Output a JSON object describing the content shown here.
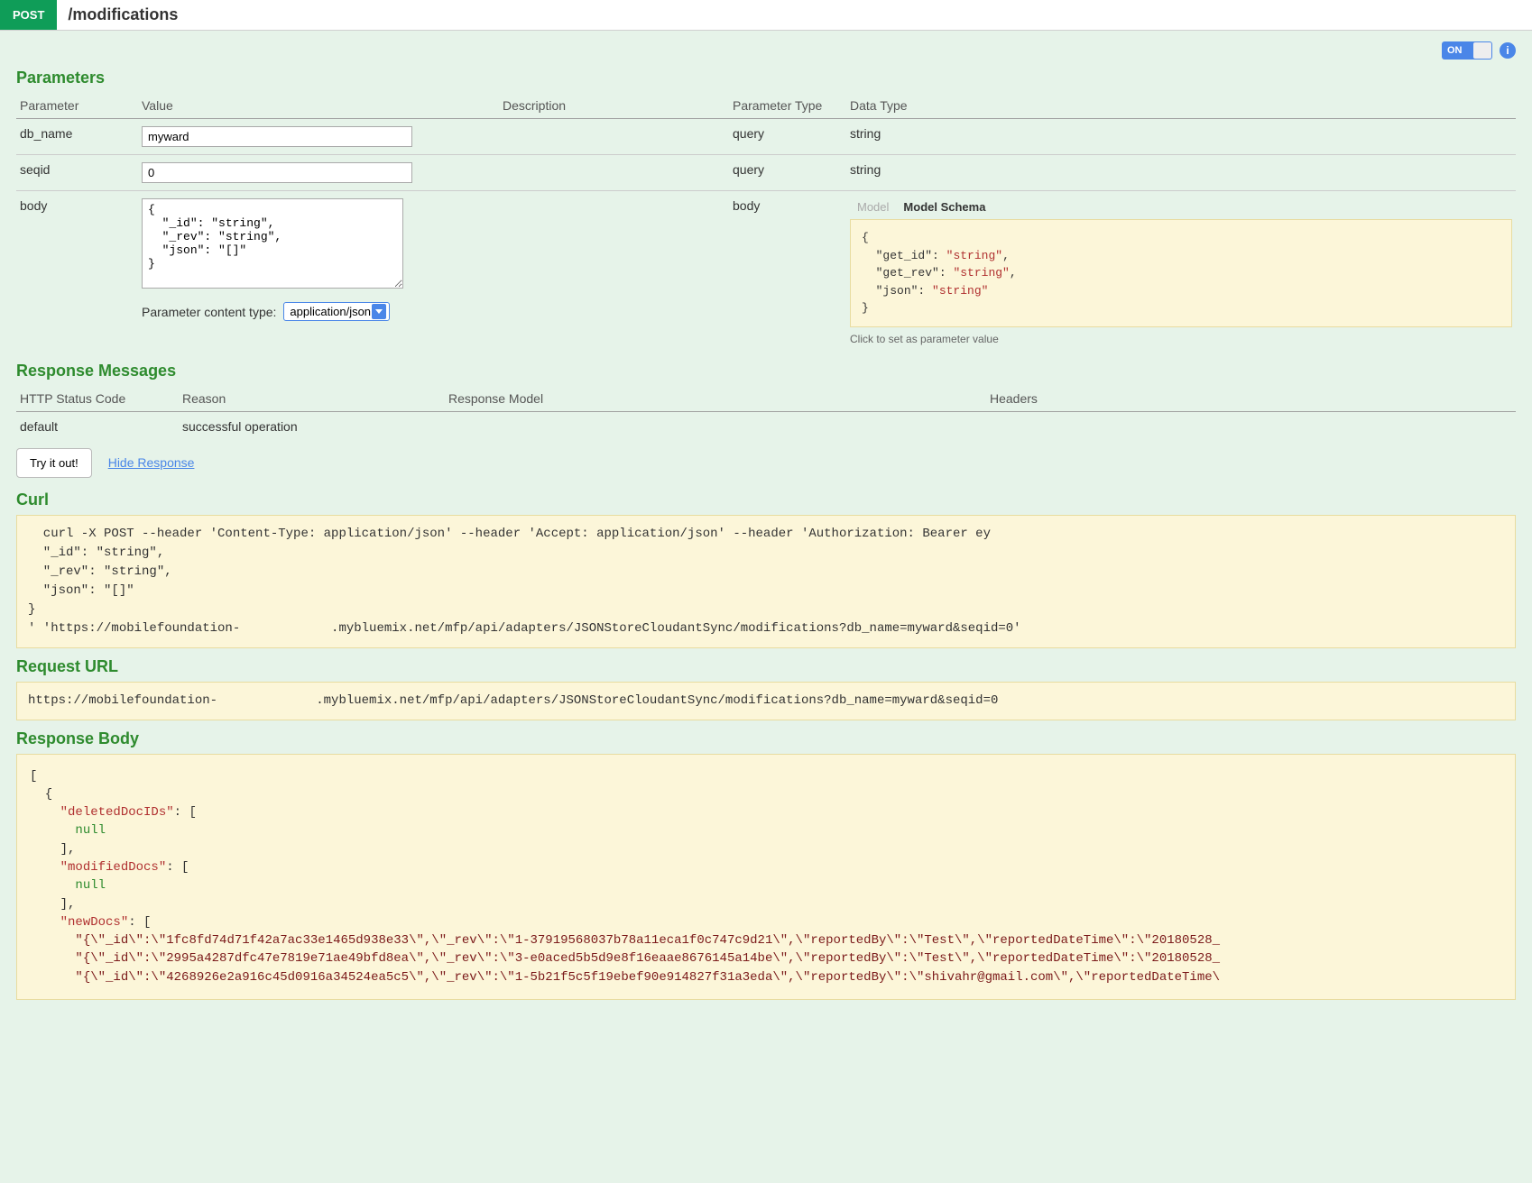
{
  "header": {
    "method": "POST",
    "path": "/modifications"
  },
  "toggle": {
    "state": "ON"
  },
  "parameters": {
    "title": "Parameters",
    "columns": {
      "param": "Parameter",
      "value": "Value",
      "desc": "Description",
      "ptype": "Parameter Type",
      "dtype": "Data Type"
    },
    "rows": {
      "db_name": {
        "name": "db_name",
        "value": "myward",
        "ptype": "query",
        "dtype": "string"
      },
      "seqid": {
        "name": "seqid",
        "value": "0",
        "ptype": "query",
        "dtype": "string"
      },
      "body": {
        "name": "body",
        "value": "{\n  \"_id\": \"string\",\n  \"_rev\": \"string\",\n  \"json\": \"[]\"\n}",
        "ptype": "body",
        "pct_label": "Parameter content type:",
        "pct_value": "application/json",
        "model_tab": "Model",
        "schema_tab": "Model Schema",
        "schema_lines": {
          "l1": "{",
          "l2a": "\"get_id\"",
          "l2b": ": ",
          "l2c": "\"string\"",
          "l2d": ",",
          "l3a": "\"get_rev\"",
          "l3b": ": ",
          "l3c": "\"string\"",
          "l3d": ",",
          "l4a": "\"json\"",
          "l4b": ": ",
          "l4c": "\"string\"",
          "l5": "}"
        },
        "click_hint": "Click to set as parameter value"
      }
    }
  },
  "responseMessages": {
    "title": "Response Messages",
    "columns": {
      "status": "HTTP Status Code",
      "reason": "Reason",
      "model": "Response Model",
      "headers": "Headers"
    },
    "row": {
      "status": "default",
      "reason": "successful operation"
    }
  },
  "actions": {
    "try": "Try it out!",
    "hide": "Hide Response"
  },
  "curl": {
    "title": "Curl",
    "text": "  curl -X POST --header 'Content-Type: application/json' --header 'Accept: application/json' --header 'Authorization: Bearer ey\n  \"_id\": \"string\",\n  \"_rev\": \"string\",\n  \"json\": \"[]\"\n}\n' 'https://mobilefoundation-            .mybluemix.net/mfp/api/adapters/JSONStoreCloudantSync/modifications?db_name=myward&seqid=0'"
  },
  "requestUrl": {
    "title": "Request URL",
    "text": "https://mobilefoundation-             .mybluemix.net/mfp/api/adapters/JSONStoreCloudantSync/modifications?db_name=myward&seqid=0"
  },
  "responseBody": {
    "title": "Response Body",
    "lines": {
      "l0": "[",
      "l1": "  {",
      "l2a": "    ",
      "l2b": "\"deletedDocIDs\"",
      "l2c": ": [",
      "l3a": "      ",
      "l3b": "null",
      "l4": "    ],",
      "l5a": "    ",
      "l5b": "\"modifiedDocs\"",
      "l5c": ": [",
      "l6a": "      ",
      "l6b": "null",
      "l7": "    ],",
      "l8a": "    ",
      "l8b": "\"newDocs\"",
      "l8c": ": [",
      "l9a": "      ",
      "l9b": "\"{\\\"_id\\\":\\\"1fc8fd74d71f42a7ac33e1465d938e33\\\",\\\"_rev\\\":\\\"1-37919568037b78a11eca1f0c747c9d21\\\",\\\"reportedBy\\\":\\\"Test\\\",\\\"reportedDateTime\\\":\\\"20180528_",
      "l10a": "      ",
      "l10b": "\"{\\\"_id\\\":\\\"2995a4287dfc47e7819e71ae49bfd8ea\\\",\\\"_rev\\\":\\\"3-e0aced5b5d9e8f16eaae8676145a14be\\\",\\\"reportedBy\\\":\\\"Test\\\",\\\"reportedDateTime\\\":\\\"20180528_",
      "l11a": "      ",
      "l11b": "\"{\\\"_id\\\":\\\"4268926e2a916c45d0916a34524ea5c5\\\",\\\"_rev\\\":\\\"1-5b21f5c5f19ebef90e914827f31a3eda\\\",\\\"reportedBy\\\":\\\"shivahr@gmail.com\\\",\\\"reportedDateTime\\"
    }
  }
}
